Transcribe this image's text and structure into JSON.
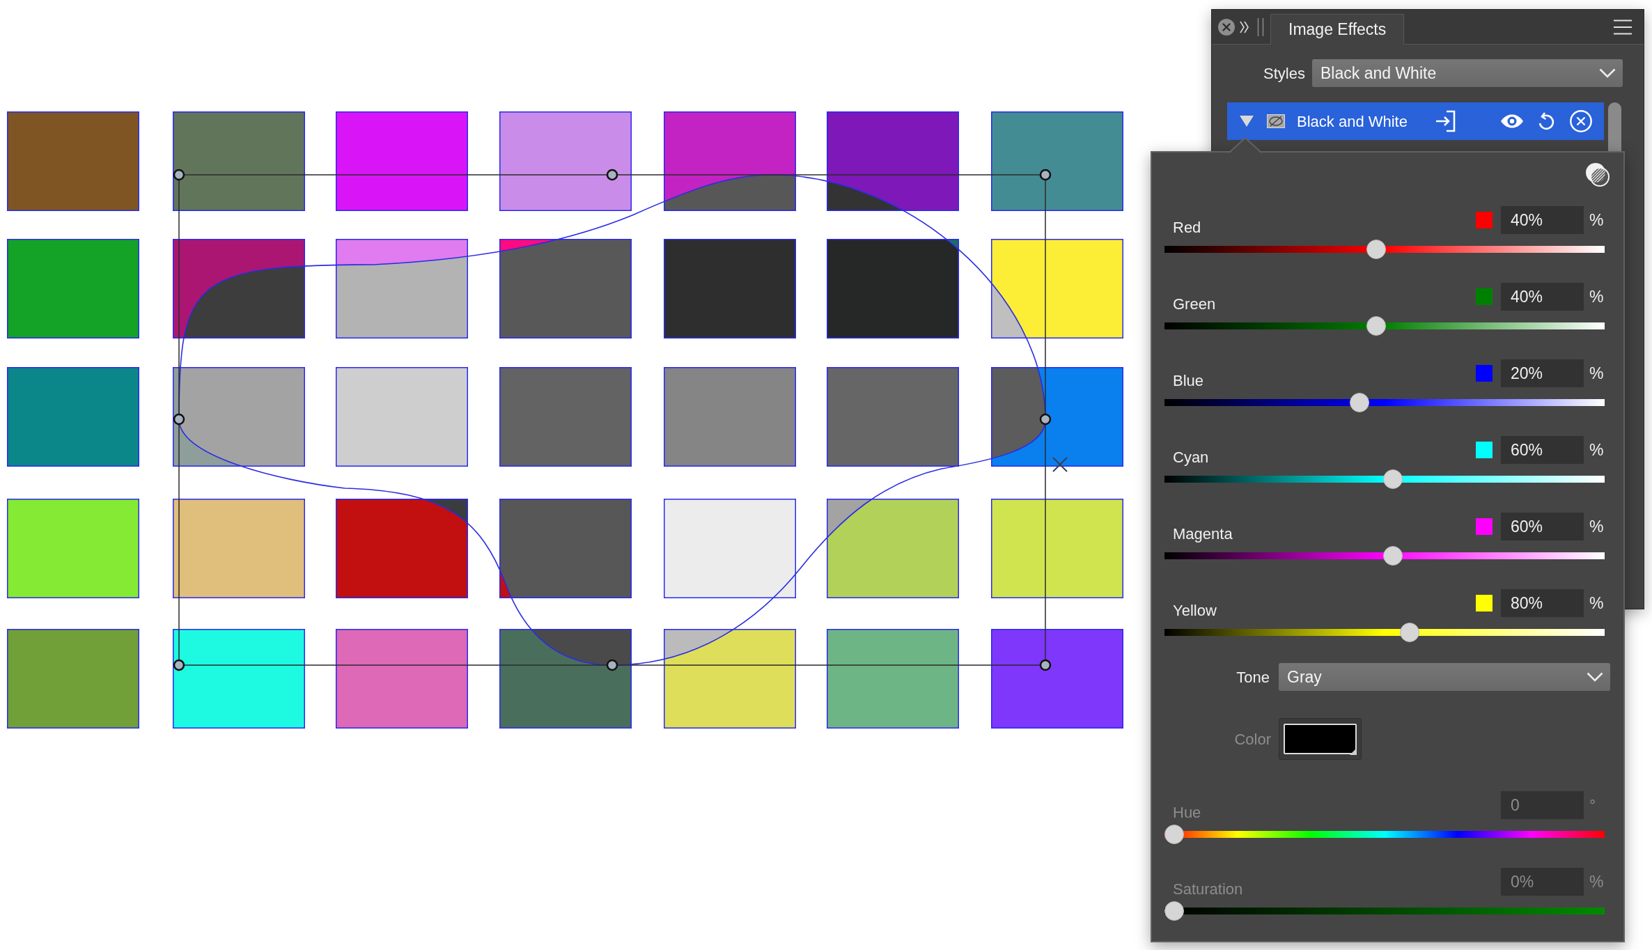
{
  "panel": {
    "tabs": [
      {
        "label": "Image Effects",
        "selected": true
      }
    ],
    "styles": {
      "label": "Styles",
      "value": "Black and White"
    },
    "effect": {
      "name": "Black and White",
      "selected": true,
      "expanded": true
    },
    "channels": [
      {
        "name": "Red",
        "color": "#ff0000",
        "value": "40%",
        "unit": "%",
        "level": 0.48
      },
      {
        "name": "Green",
        "color": "#008000",
        "value": "40%",
        "unit": "%",
        "level": 0.48
      },
      {
        "name": "Blue",
        "color": "#0000ff",
        "value": "20%",
        "unit": "%",
        "level": 0.44
      },
      {
        "name": "Cyan",
        "color": "#00ffff",
        "value": "60%",
        "unit": "%",
        "level": 0.52
      },
      {
        "name": "Magenta",
        "color": "#ff00ff",
        "value": "60%",
        "unit": "%",
        "level": 0.52
      },
      {
        "name": "Yellow",
        "color": "#ffff00",
        "value": "80%",
        "unit": "%",
        "level": 0.56
      }
    ],
    "tone": {
      "label": "Tone",
      "value": "Gray"
    },
    "color_well": {
      "label": "Color",
      "color": "#000000",
      "disabled": true
    },
    "hue": {
      "label": "Hue",
      "value": "0",
      "unit": "°",
      "level": 0,
      "disabled": true
    },
    "saturation": {
      "label": "Saturation",
      "value": "0%",
      "unit": "%",
      "level": 0,
      "disabled": true
    }
  }
}
